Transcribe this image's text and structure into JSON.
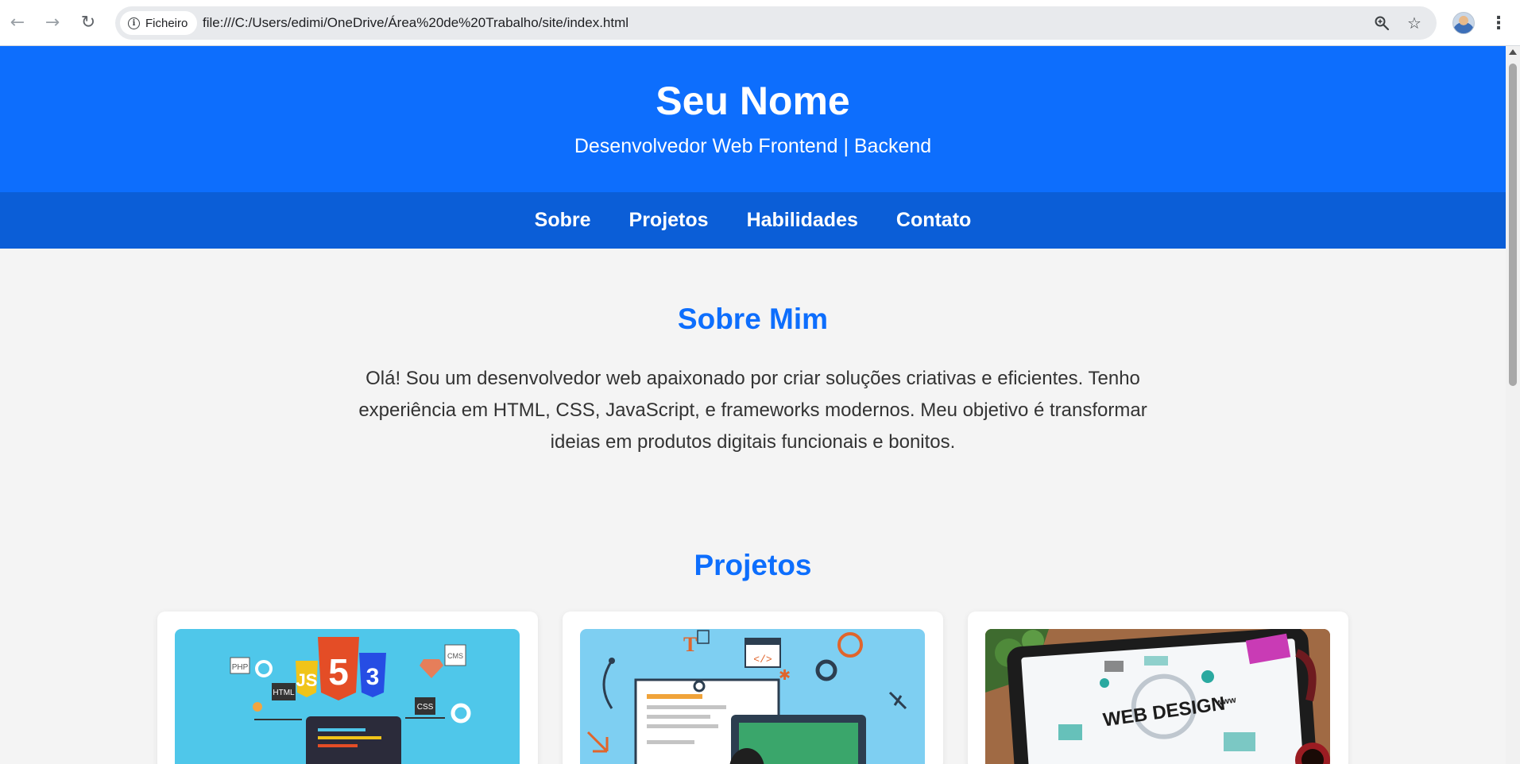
{
  "browser": {
    "site_chip_label": "Ficheiro",
    "url": "file:///C:/Users/edimi/OneDrive/Área%20de%20Trabalho/site/index.html"
  },
  "header": {
    "title": "Seu Nome",
    "subtitle": "Desenvolvedor Web Frontend | Backend"
  },
  "nav": {
    "items": [
      {
        "label": "Sobre"
      },
      {
        "label": "Projetos"
      },
      {
        "label": "Habilidades"
      },
      {
        "label": "Contato"
      }
    ]
  },
  "about": {
    "title": "Sobre Mim",
    "text": "Olá! Sou um desenvolvedor web apaixonado por criar soluções criativas e eficientes. Tenho experiência em HTML, CSS, JavaScript, e frameworks modernos. Meu objetivo é transformar ideias em produtos digitais funcionais e bonitos."
  },
  "projects": {
    "title": "Projetos",
    "cards": [
      {
        "image_labels": [
          "PHP",
          "HTML",
          "JS",
          "5",
          "3",
          "CSS",
          "CMS"
        ]
      },
      {
        "image_labels": [
          "T",
          "</>"
        ]
      },
      {
        "image_labels": [
          "WEB DESIGN",
          "www"
        ]
      }
    ]
  },
  "colors": {
    "header_bg": "#0d6efd",
    "nav_bg": "#0b5ed7",
    "accent": "#0d6efd",
    "page_bg": "#f4f4f4"
  }
}
